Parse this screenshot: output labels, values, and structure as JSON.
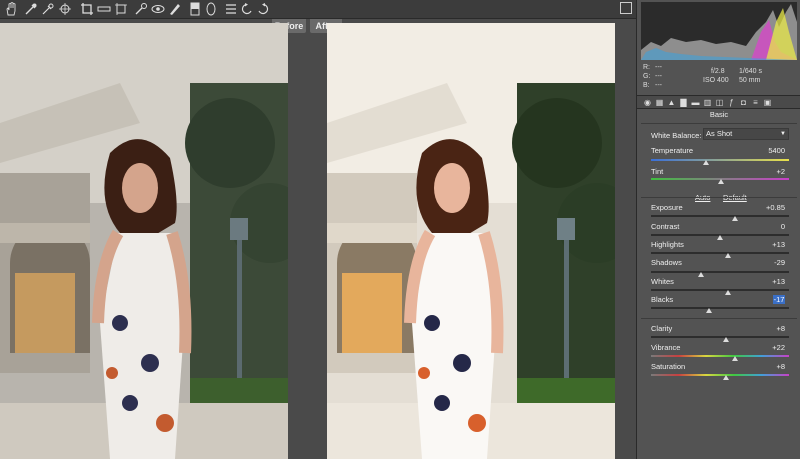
{
  "toolbar": {
    "tools": [
      {
        "icon": "hand-icon"
      },
      {
        "icon": "eyedropper-icon"
      },
      {
        "icon": "color-sampler-icon"
      },
      {
        "icon": "target-adjust-icon"
      },
      {
        "icon": "crop-icon"
      },
      {
        "icon": "straighten-icon"
      },
      {
        "icon": "transform-icon"
      },
      {
        "icon": "spot-removal-icon"
      },
      {
        "icon": "red-eye-icon"
      },
      {
        "icon": "adjustment-brush-icon"
      },
      {
        "icon": "graduated-filter-icon"
      },
      {
        "icon": "radial-filter-icon"
      },
      {
        "icon": "preferences-icon"
      },
      {
        "icon": "rotate-left-icon"
      },
      {
        "icon": "rotate-right-icon"
      }
    ]
  },
  "views": {
    "before_label": "Before",
    "after_label": "After"
  },
  "readout": {
    "r_label": "R:",
    "r_value": "---",
    "g_label": "G:",
    "g_value": "---",
    "b_label": "B:",
    "b_value": "---",
    "aperture": "f/2.8",
    "shutter": "1/640 s",
    "iso": "ISO 400",
    "focal": "50 mm"
  },
  "panel": {
    "title": "Basic",
    "white_balance_label": "White Balance:",
    "white_balance_value": "As Shot",
    "auto_label": "Auto",
    "default_label": "Default",
    "sliders": [
      {
        "label": "Temperature",
        "value": "5400",
        "pos": 0.4
      },
      {
        "label": "Tint",
        "value": "+2",
        "pos": 0.51
      },
      {
        "label": "Exposure",
        "value": "+0.85",
        "pos": 0.61
      },
      {
        "label": "Contrast",
        "value": "0",
        "pos": 0.5
      },
      {
        "label": "Highlights",
        "value": "+13",
        "pos": 0.56
      },
      {
        "label": "Shadows",
        "value": "-29",
        "pos": 0.36
      },
      {
        "label": "Whites",
        "value": "+13",
        "pos": 0.56
      },
      {
        "label": "Blacks",
        "value": "-17",
        "pos": 0.42
      },
      {
        "label": "Clarity",
        "value": "+8",
        "pos": 0.54
      },
      {
        "label": "Vibrance",
        "value": "+22",
        "pos": 0.61
      },
      {
        "label": "Saturation",
        "value": "+8",
        "pos": 0.54
      }
    ]
  }
}
